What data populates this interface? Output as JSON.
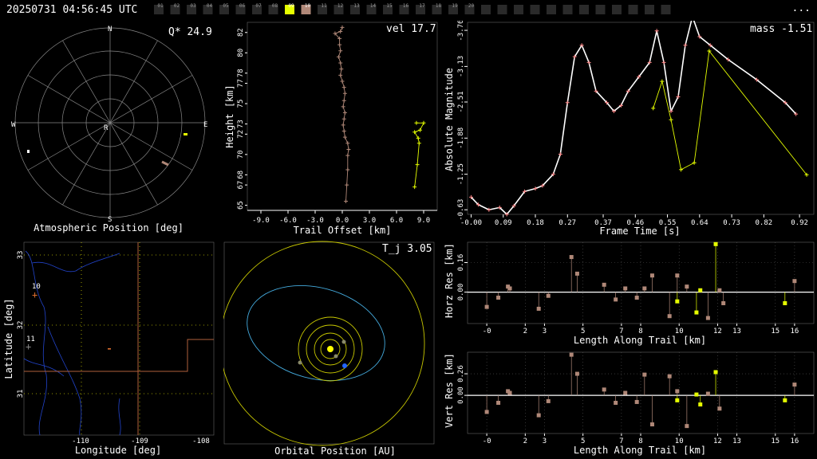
{
  "header": {
    "datetime": "20250731 04:56:45 UTC",
    "more_label": "..."
  },
  "stations": {
    "labels": [
      "01",
      "02",
      "03",
      "04",
      "05",
      "06",
      "07",
      "08",
      "09",
      "10",
      "11",
      "12",
      "13",
      "14",
      "15",
      "16",
      "17",
      "18",
      "19",
      "20"
    ],
    "active_yellow": "09",
    "active_tan": "10",
    "colors": {
      "inactive": "#2a2a2a",
      "yellow": "#e6ff00",
      "tan": "#b08878"
    }
  },
  "radar": {
    "title": "Atmospheric Position [deg]",
    "readout": "Q* 24.9",
    "compass": {
      "n": "N",
      "s": "S",
      "e": "E",
      "w": "W"
    },
    "center_label": "R"
  },
  "trail": {
    "title": "Trail Offset [km]",
    "ylabel": "Height [km]",
    "readout": "vel 17.7",
    "xticks": [
      "-9.0",
      "-6.0",
      "-3.0",
      "0.0",
      "3.0",
      "6.0",
      "9.0"
    ],
    "yticks": [
      "65",
      "67",
      "68",
      "70",
      "72",
      "73",
      "75",
      "77",
      "78",
      "80",
      "82"
    ]
  },
  "mag": {
    "xlabel": "Frame Time [s]",
    "ylabel": "Absolute Magnitude",
    "readout": "mass -1.51",
    "xticks": [
      "-0.00",
      "0.09",
      "0.18",
      "0.27",
      "0.37",
      "0.46",
      "0.55",
      "0.64",
      "0.73",
      "0.82",
      "0.92"
    ],
    "yticks": [
      "-3.76",
      "-3.13",
      "-2.51",
      "-1.88",
      "-1.25",
      "-0.63"
    ]
  },
  "map": {
    "xlabel": "Longitude [deg]",
    "ylabel": "Latitude [deg]",
    "xticks": [
      "-110",
      "-109",
      "-108"
    ],
    "yticks": [
      "33",
      "32",
      "31"
    ],
    "station_labels": [
      "10",
      "11"
    ]
  },
  "orbit": {
    "title": "Orbital Position [AU]",
    "readout": "T_j 3.05"
  },
  "horz": {
    "xlabel": "Length Along Trail [km]",
    "ylabel": "Horz Res [km]",
    "xticks": [
      "-0",
      "2",
      "3",
      "5",
      "7",
      "8",
      "10",
      "12",
      "13",
      "15",
      "16"
    ],
    "yticks": [
      "0.16",
      "0.00"
    ]
  },
  "vert": {
    "xlabel": "Length Along Trail [km]",
    "ylabel": "Vert Res [km]",
    "xticks": [
      "-0",
      "2",
      "3",
      "5",
      "7",
      "8",
      "10",
      "12",
      "13",
      "15",
      "16"
    ],
    "yticks": [
      "0.26",
      "0.00"
    ]
  },
  "chart_data": [
    {
      "type": "line",
      "panel": "trail",
      "xlabel": "Trail Offset [km]",
      "ylabel": "Height [km]",
      "xlim": [
        -10.5,
        10.5
      ],
      "ylim": [
        64.5,
        83
      ],
      "series": [
        {
          "color": "#b08878",
          "points": [
            [
              0.0,
              82.5
            ],
            [
              -0.2,
              82.1
            ],
            [
              -0.8,
              81.9
            ],
            [
              -0.3,
              81.4
            ],
            [
              -0.3,
              80.8
            ],
            [
              -0.2,
              80.2
            ],
            [
              -0.4,
              79.6
            ],
            [
              -0.2,
              79.0
            ],
            [
              -0.1,
              78.4
            ],
            [
              -0.2,
              77.8
            ],
            [
              0.0,
              77.2
            ],
            [
              0.2,
              76.6
            ],
            [
              0.3,
              76.0
            ],
            [
              0.2,
              75.3
            ],
            [
              0.1,
              74.7
            ],
            [
              0.3,
              74.1
            ],
            [
              0.2,
              73.5
            ],
            [
              0.1,
              72.9
            ],
            [
              0.2,
              72.3
            ],
            [
              0.3,
              71.7
            ],
            [
              0.6,
              71.1
            ],
            [
              0.7,
              70.5
            ],
            [
              0.6,
              69.9
            ],
            [
              0.6,
              68.5
            ],
            [
              0.5,
              67.0
            ],
            [
              0.4,
              65.4
            ]
          ]
        },
        {
          "color": "#e6ff00",
          "points": [
            [
              8.2,
              73.1
            ],
            [
              9.0,
              73.1
            ],
            [
              8.6,
              72.4
            ],
            [
              8.0,
              72.2
            ],
            [
              8.4,
              71.6
            ],
            [
              8.5,
              71.1
            ],
            [
              8.3,
              69.0
            ],
            [
              8.0,
              66.8
            ]
          ]
        }
      ]
    },
    {
      "type": "line",
      "panel": "magnitude",
      "xlabel": "Frame Time [s]",
      "ylabel": "Absolute Magnitude",
      "xlim": [
        -0.01,
        0.96
      ],
      "ylim": [
        -3.9,
        -0.55
      ],
      "series": [
        {
          "color": "#ffffff",
          "points": [
            [
              0.0,
              -0.85
            ],
            [
              0.02,
              -0.72
            ],
            [
              0.05,
              -0.63
            ],
            [
              0.08,
              -0.67
            ],
            [
              0.1,
              -0.55
            ],
            [
              0.12,
              -0.7
            ],
            [
              0.15,
              -0.95
            ],
            [
              0.18,
              -1.0
            ],
            [
              0.2,
              -1.05
            ],
            [
              0.23,
              -1.25
            ],
            [
              0.25,
              -1.6
            ],
            [
              0.27,
              -2.5
            ],
            [
              0.29,
              -3.3
            ],
            [
              0.31,
              -3.5
            ],
            [
              0.33,
              -3.2
            ],
            [
              0.35,
              -2.7
            ],
            [
              0.38,
              -2.5
            ],
            [
              0.4,
              -2.35
            ],
            [
              0.42,
              -2.45
            ],
            [
              0.44,
              -2.7
            ],
            [
              0.47,
              -2.95
            ],
            [
              0.5,
              -3.2
            ],
            [
              0.52,
              -3.75
            ],
            [
              0.54,
              -3.2
            ],
            [
              0.56,
              -2.35
            ],
            [
              0.58,
              -2.6
            ],
            [
              0.6,
              -3.5
            ],
            [
              0.62,
              -4.0
            ],
            [
              0.64,
              -3.65
            ],
            [
              0.67,
              -3.5
            ],
            [
              0.72,
              -3.25
            ],
            [
              0.8,
              -2.9
            ],
            [
              0.88,
              -2.5
            ],
            [
              0.91,
              -2.3
            ]
          ]
        },
        {
          "color": "#e6ff00",
          "points": [
            [
              0.51,
              -2.4
            ],
            [
              0.535,
              -2.87
            ],
            [
              0.56,
              -2.2
            ],
            [
              0.588,
              -1.33
            ],
            [
              0.625,
              -1.45
            ],
            [
              0.667,
              -3.4
            ],
            [
              0.94,
              -1.24
            ]
          ]
        }
      ]
    },
    {
      "type": "scatter",
      "panel": "horizontal_residuals",
      "xlabel": "Length Along Trail [km]",
      "ylabel": "Horz Res [km]",
      "xlim": [
        -1.0,
        17.0
      ],
      "ylim": [
        -0.17,
        0.27
      ],
      "series": [
        {
          "color": "#b08878",
          "points": [
            [
              0.0,
              -0.08
            ],
            [
              0.6,
              -0.03
            ],
            [
              1.1,
              0.03
            ],
            [
              1.2,
              0.02
            ],
            [
              2.7,
              -0.09
            ],
            [
              3.2,
              -0.02
            ],
            [
              4.4,
              0.19
            ],
            [
              4.7,
              0.1
            ],
            [
              6.1,
              0.04
            ],
            [
              6.7,
              -0.04
            ],
            [
              7.2,
              0.02
            ],
            [
              7.8,
              -0.03
            ],
            [
              8.2,
              0.02
            ],
            [
              8.6,
              0.09
            ],
            [
              9.5,
              -0.13
            ],
            [
              9.9,
              0.09
            ],
            [
              10.4,
              0.03
            ],
            [
              11.5,
              -0.14
            ],
            [
              12.1,
              0.01
            ],
            [
              12.3,
              -0.06
            ],
            [
              16.0,
              0.06
            ]
          ]
        },
        {
          "color": "#e6ff00",
          "points": [
            [
              9.9,
              -0.05
            ],
            [
              10.9,
              -0.11
            ],
            [
              11.1,
              0.01
            ],
            [
              11.9,
              0.26
            ],
            [
              15.5,
              -0.06
            ]
          ]
        }
      ]
    },
    {
      "type": "scatter",
      "panel": "vertical_residuals",
      "xlabel": "Length Along Trail [km]",
      "ylabel": "Vert Res [km]",
      "xlim": [
        -1.0,
        17.0
      ],
      "ylim": [
        -0.46,
        0.52
      ],
      "series": [
        {
          "color": "#b08878",
          "points": [
            [
              0.0,
              -0.2
            ],
            [
              0.6,
              -0.09
            ],
            [
              1.1,
              0.05
            ],
            [
              1.2,
              0.03
            ],
            [
              2.7,
              -0.24
            ],
            [
              3.2,
              -0.07
            ],
            [
              4.4,
              0.49
            ],
            [
              4.7,
              0.26
            ],
            [
              6.1,
              0.07
            ],
            [
              6.7,
              -0.09
            ],
            [
              7.2,
              0.03
            ],
            [
              7.8,
              -0.08
            ],
            [
              8.2,
              0.25
            ],
            [
              8.6,
              -0.35
            ],
            [
              9.5,
              0.23
            ],
            [
              9.9,
              0.05
            ],
            [
              10.4,
              -0.37
            ],
            [
              11.5,
              0.02
            ],
            [
              12.1,
              -0.16
            ],
            [
              16.0,
              0.13
            ]
          ]
        },
        {
          "color": "#e6ff00",
          "points": [
            [
              9.9,
              -0.06
            ],
            [
              10.9,
              0.01
            ],
            [
              11.1,
              -0.11
            ],
            [
              11.9,
              0.28
            ],
            [
              15.5,
              -0.06
            ]
          ]
        }
      ]
    }
  ]
}
